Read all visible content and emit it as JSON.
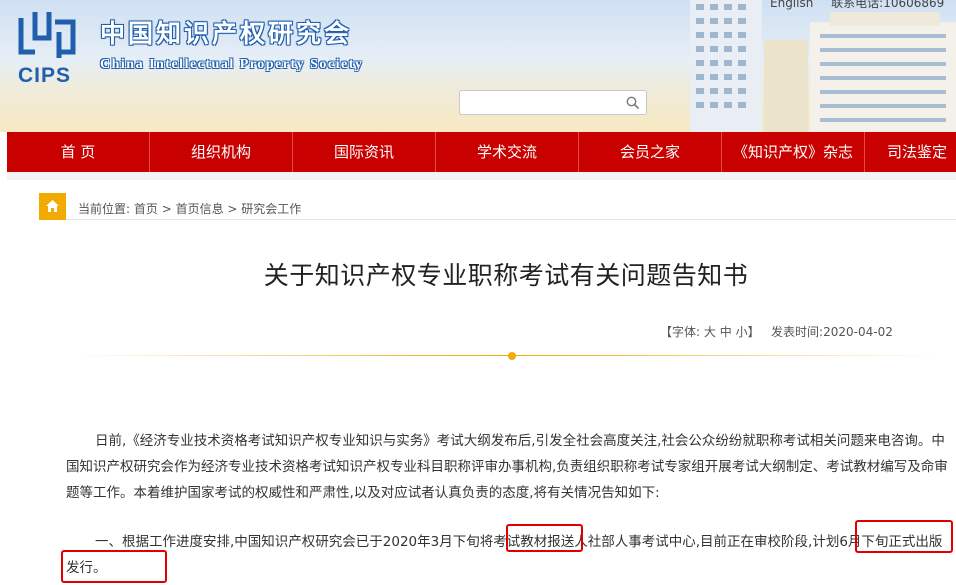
{
  "header": {
    "logo_text": "CIPS",
    "site_title_cn": "中国知识产权研究会",
    "site_title_en": "China Intellectual Property Society",
    "top_links": [
      "English",
      "联系电话:10606869"
    ],
    "search_placeholder": ""
  },
  "nav": {
    "items": [
      {
        "label": "首 页"
      },
      {
        "label": "组织机构"
      },
      {
        "label": "国际资讯"
      },
      {
        "label": "学术交流"
      },
      {
        "label": "会员之家"
      },
      {
        "label": "《知识产权》杂志"
      },
      {
        "label": "司法鉴定"
      }
    ]
  },
  "breadcrumb": {
    "prefix": "当前位置:",
    "items": [
      "首页",
      "首页信息",
      "研究会工作"
    ],
    "separator": " > "
  },
  "article": {
    "title": "关于知识产权专业职称考试有关问题告知书",
    "font_label": "【字体:",
    "size_large": "大",
    "size_medium": "中",
    "size_small": "小",
    "font_label_end": "】",
    "date_label": "发表时间:",
    "date": "2020-04-02",
    "paragraph1": "日前,《经济专业技术资格考试知识产权专业知识与实务》考试大纲发布后,引发全社会高度关注,社会公众纷纷就职称考试相关问题来电咨询。中国知识产权研究会作为经济专业技术资格考试知识产权专业科目职称评审办事机构,负责组织职称考试专家组开展考试大纲制定、考试教材编写及命审题等工作。本着维护国家考试的权威性和严肃性,以及对应试者认真负责的态度,将有关情况告知如下:",
    "paragraph2": "一、根据工作进度安排,中国知识产权研究会已于2020年3月下旬将考试教材报送人社部人事考试中心,目前正在审校阶段,计划6月下旬正式出版发行。"
  },
  "colors": {
    "nav_bg": "#c80000",
    "accent": "#f2a900",
    "brand_blue": "#1f5fae",
    "highlight_box": "#e00000"
  }
}
